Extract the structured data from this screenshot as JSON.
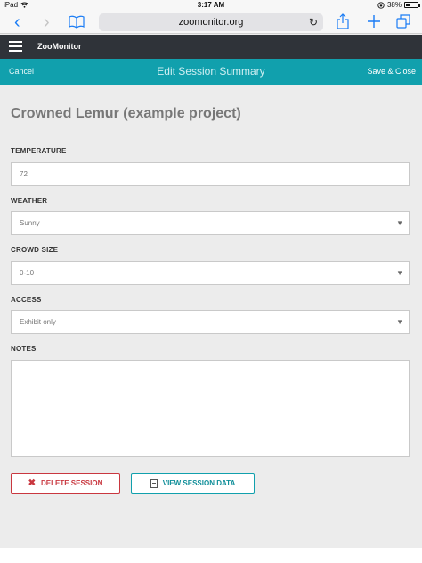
{
  "status_bar": {
    "device": "iPad",
    "time": "3:17 AM",
    "battery": "38%",
    "battery_level": 0.38
  },
  "browser": {
    "url": "zoomonitor.org"
  },
  "app": {
    "brand": "ZooMonitor"
  },
  "edit_bar": {
    "cancel": "Cancel",
    "title": "Edit Session Summary",
    "save": "Save & Close"
  },
  "project": {
    "title": "Crowned Lemur (example project)"
  },
  "fields": {
    "temperature": {
      "label": "TEMPERATURE",
      "value": "72"
    },
    "weather": {
      "label": "WEATHER",
      "value": "Sunny"
    },
    "crowd_size": {
      "label": "CROWD SIZE",
      "value": "0-10"
    },
    "access": {
      "label": "ACCESS",
      "value": "Exhibit only"
    },
    "notes": {
      "label": "NOTES",
      "value": ""
    }
  },
  "buttons": {
    "delete": "DELETE SESSION",
    "view": "VIEW SESSION DATA"
  },
  "icons": {
    "wifi": "wifi-icon",
    "orientation_lock": "orientation-lock-icon",
    "back": "chevron-left-icon",
    "forward": "chevron-right-icon",
    "bookmarks": "book-icon",
    "reload": "reload-icon",
    "share": "share-icon",
    "new_tab": "plus-icon",
    "tabs": "tabs-icon",
    "menu": "hamburger-icon",
    "delete": "close-icon",
    "view": "document-icon",
    "dropdown": "caret-down-icon"
  },
  "colors": {
    "app_header": "#2f3339",
    "edit_bar": "#11a0ad",
    "delete": "#c9373f",
    "view": "#11a0ad",
    "ios_blue": "#1a7cf5"
  }
}
